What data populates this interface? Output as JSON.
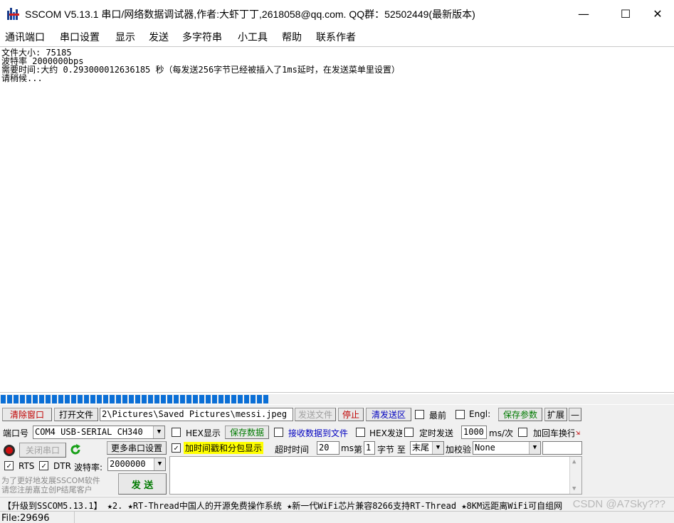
{
  "window": {
    "title": "SSCOM V5.13.1 串口/网络数据调试器,作者:大虾丁丁,2618058@qq.com. QQ群：52502449(最新版本)",
    "minimize": "—",
    "maximize": "☐",
    "close": "✕"
  },
  "menu": [
    "通讯端口",
    "串口设置",
    "显示",
    "发送",
    "多字符串",
    "小工具",
    "帮助",
    "联系作者"
  ],
  "output": {
    "lines": [
      "文件大小: 75185",
      "波特率 2000000bps",
      "需要时间:大约 0.293000012636185 秒（每发送256字节已经被插入了1ms延时，在发送菜单里设置）",
      "请稍候..."
    ]
  },
  "progress": {
    "fraction": 0.4
  },
  "toolbar": {
    "clear_window": "清除窗口",
    "open_file": "打开文件",
    "file_path": "2\\Pictures\\Saved Pictures\\messi.jpeg",
    "send_file": "发送文件",
    "stop": "停止",
    "clear_send": "清发送区",
    "topmost": "最前",
    "english": "Engl:",
    "save_params": "保存参数",
    "expand": "扩展",
    "collapse": "—"
  },
  "port": {
    "port_label": "端口号",
    "port_value": "COM4 USB-SERIAL CH340",
    "close_port": "关闭串口",
    "more_settings": "更多串口设置",
    "rts": "RTS",
    "dtr": "DTR",
    "baud_label": "波特率:",
    "baud_value": "2000000",
    "promo_line1": "为了更好地发展SSCOM软件",
    "promo_line2": "请您注册嘉立创P结尾客户"
  },
  "options": {
    "hex_display": "HEX显示",
    "save_data": "保存数据",
    "recv_to_file": "接收数据到文件",
    "hex_send": "HEX发送",
    "timed_send": "定时发送",
    "interval_value": "1000",
    "interval_unit": "ms/次",
    "add_crlf": "加回车换行",
    "timestamp": "加时间戳和分包显示",
    "timeout_label": "超时时间",
    "timeout_value": "20",
    "timeout_unit": "ms",
    "byte_label": "第",
    "byte_value": "1",
    "byte_unit": "字节 至",
    "tail_value": "末尾",
    "checksum_label": "加校验",
    "checksum_value": "None",
    "send": "发 送"
  },
  "statusbar": {
    "ticker": "【升级到SSCOM5.13.1】 ★2. ★RT-Thread中国人的开源免费操作系统 ★新一代WiFi芯片兼容8266支持RT-Thread ★8KM远距离WiFi可自组网",
    "file_status": "File:29696",
    "watermark": "CSDN @A7Sky???"
  }
}
